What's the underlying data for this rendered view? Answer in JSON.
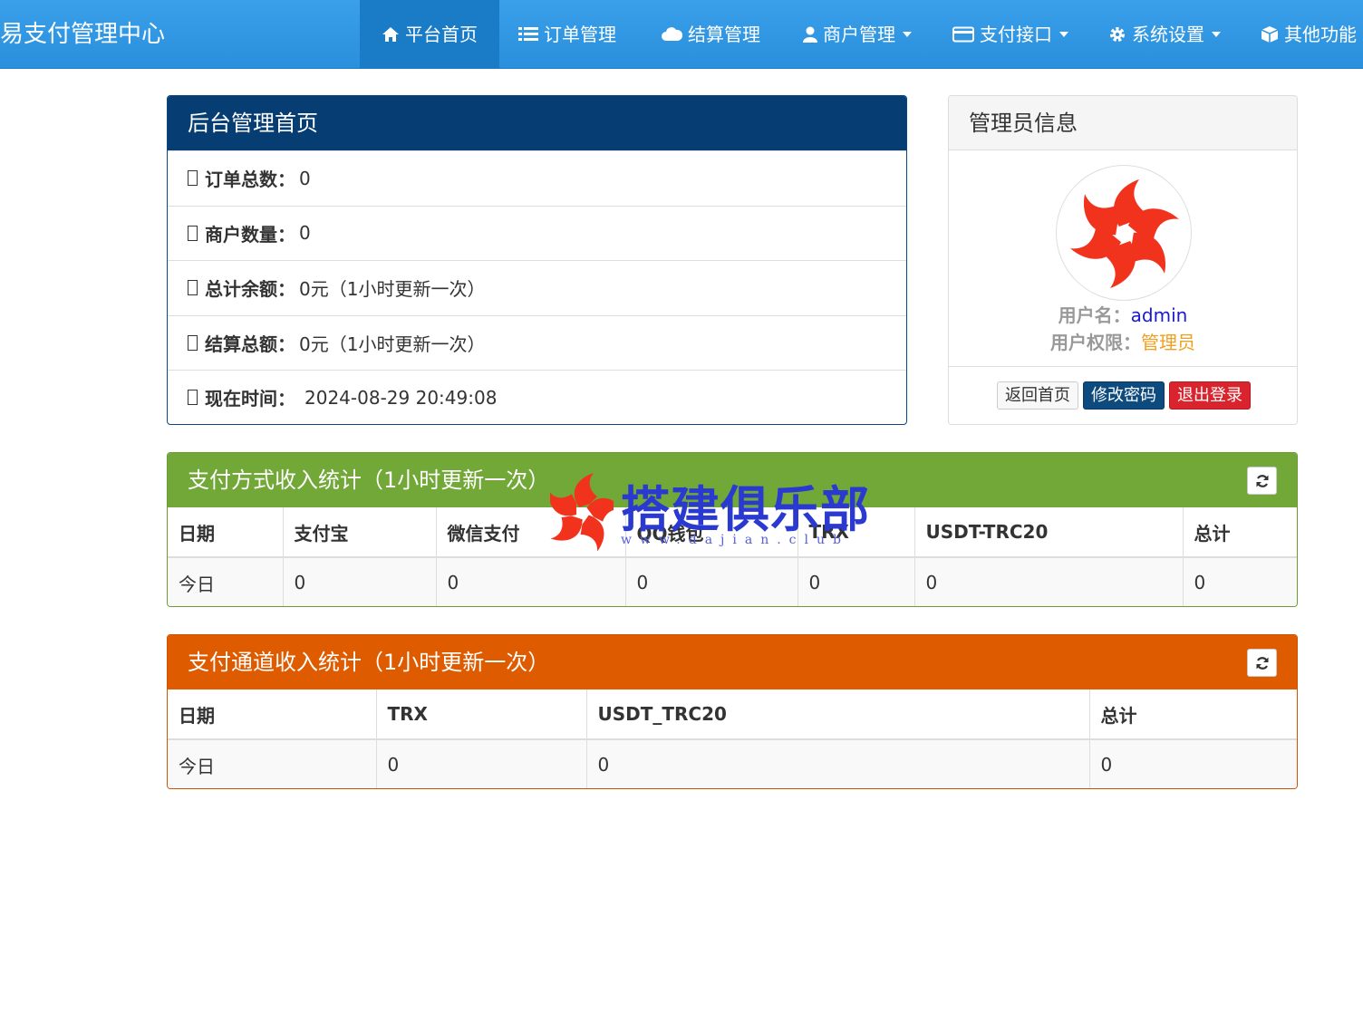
{
  "app": {
    "brand": "易支付管理中心"
  },
  "nav": {
    "items": [
      {
        "label": "平台首页",
        "icon": "home-icon"
      },
      {
        "label": "订单管理",
        "icon": "list-icon"
      },
      {
        "label": "结算管理",
        "icon": "cloud-icon"
      },
      {
        "label": "商户管理",
        "icon": "user-icon"
      },
      {
        "label": "支付接口",
        "icon": "card-icon"
      },
      {
        "label": "系统设置",
        "icon": "gear-icon"
      },
      {
        "label": "其他功能",
        "icon": "cube-icon"
      }
    ]
  },
  "dashboard": {
    "title": "后台管理首页",
    "rows": [
      {
        "label": "订单总数：",
        "value": "0"
      },
      {
        "label": "商户数量：",
        "value": "0"
      },
      {
        "label": "总计余额：",
        "value": "0元（1小时更新一次）"
      },
      {
        "label": "结算总额：",
        "value": "0元（1小时更新一次）"
      },
      {
        "label": "现在时间：",
        "value": "2024-08-29 20:49:08"
      }
    ]
  },
  "admin": {
    "title": "管理员信息",
    "username_label": "用户名：",
    "username": "admin",
    "role_label": "用户权限：",
    "role": "管理员",
    "buttons": {
      "home": "返回首页",
      "password": "修改密码",
      "logout": "退出登录"
    }
  },
  "method_stats": {
    "title": "支付方式收入统计（1小时更新一次）",
    "columns": [
      "日期",
      "支付宝",
      "微信支付",
      "QQ钱包",
      "TRX",
      "USDT-TRC20",
      "总计"
    ],
    "rows": [
      [
        "今日",
        "0",
        "0",
        "0",
        "0",
        "0",
        "0"
      ]
    ]
  },
  "channel_stats": {
    "title": "支付通道收入统计（1小时更新一次）",
    "columns": [
      "日期",
      "TRX",
      "USDT_TRC20",
      "总计"
    ],
    "rows": [
      [
        "今日",
        "0",
        "0",
        "0"
      ]
    ]
  },
  "watermark": {
    "title": "搭建俱乐部",
    "sub": "www.dajian.club"
  },
  "colors": {
    "nav": "#2a8fdc",
    "dashboard_header": "#063d73",
    "method_header": "#72a837",
    "channel_header": "#df5b00",
    "username": "#1a1ad0",
    "role": "#f0a020"
  }
}
